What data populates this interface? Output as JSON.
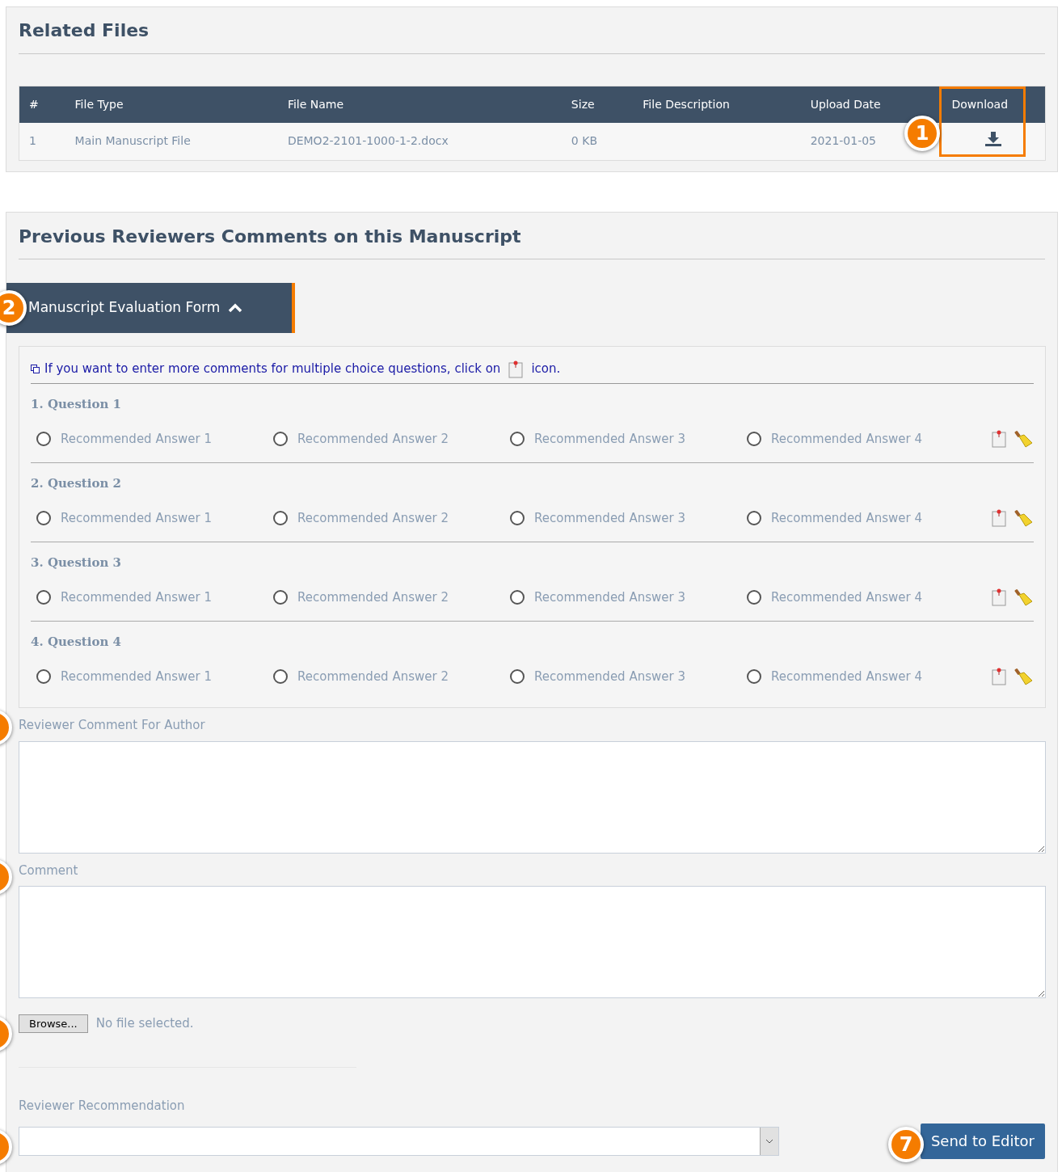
{
  "related_files": {
    "title": "Related Files",
    "table": {
      "columns": [
        "#",
        "File Type",
        "File Name",
        "Size",
        "File Description",
        "Upload Date",
        "Download"
      ],
      "rows": [
        {
          "cells": [
            "1",
            "Main Manuscript File",
            "DEMO2-2101-1000-1-2.docx",
            "0 KB",
            "",
            "2021-01-05"
          ]
        }
      ]
    },
    "download_callout": "1"
  },
  "reviews": {
    "title": "Previous Reviewers Comments on this Manuscript",
    "tab": {
      "label": "Manuscript Evaluation Form",
      "expanded": true,
      "callout": "2"
    },
    "hint": {
      "before": "If you want to enter more comments for multiple choice questions, click on",
      "after": "icon."
    },
    "questions": [
      {
        "title": "1. Question 1",
        "answers": [
          {
            "label": "Recommended Answer 1",
            "selected": false
          },
          {
            "label": "Recommended Answer 2",
            "selected": false
          },
          {
            "label": "Recommended Answer 3",
            "selected": false
          },
          {
            "label": "Recommended Answer 4",
            "selected": false
          }
        ]
      },
      {
        "title": "2. Question 2",
        "answers": [
          {
            "label": "Recommended Answer 1",
            "selected": false
          },
          {
            "label": "Recommended Answer 2",
            "selected": false
          },
          {
            "label": "Recommended Answer 3",
            "selected": false
          },
          {
            "label": "Recommended Answer 4",
            "selected": false
          }
        ]
      },
      {
        "title": "3. Question 3",
        "answers": [
          {
            "label": "Recommended Answer 1",
            "selected": false
          },
          {
            "label": "Recommended Answer 2",
            "selected": false
          },
          {
            "label": "Recommended Answer 3",
            "selected": false
          },
          {
            "label": "Recommended Answer 4",
            "selected": false
          }
        ]
      },
      {
        "title": "4. Question 4",
        "answers": [
          {
            "label": "Recommended Answer 1",
            "selected": false
          },
          {
            "label": "Recommended Answer 2",
            "selected": false
          },
          {
            "label": "Recommended Answer 3",
            "selected": false
          },
          {
            "label": "Recommended Answer 4",
            "selected": false
          }
        ]
      }
    ],
    "author_comment": {
      "label": "Reviewer Comment For Author"
    },
    "comment": {
      "label": "Comment"
    },
    "file_input": {
      "button": "Browse...",
      "status": "No file selected."
    },
    "recommendation": {
      "label": "Reviewer Recommendation"
    },
    "send_button": {
      "label": "Send to Editor",
      "callout": "7"
    }
  }
}
